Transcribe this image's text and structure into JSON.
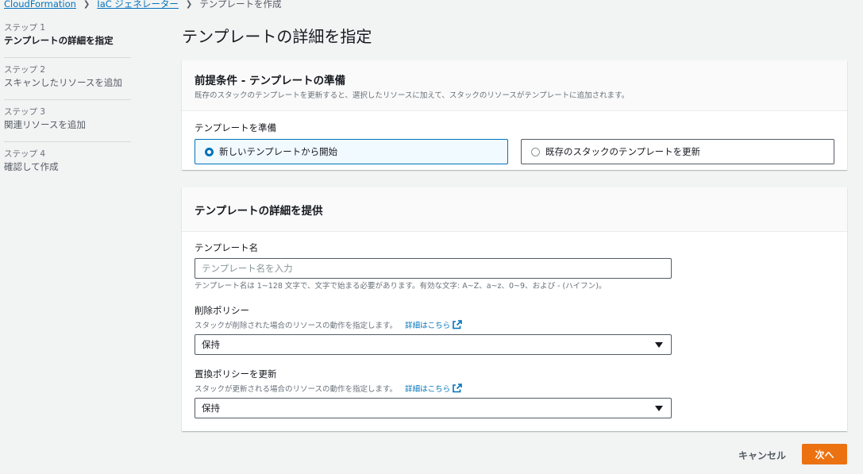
{
  "breadcrumb": {
    "items": [
      "CloudFormation",
      "IaC ジェネレーター"
    ],
    "current": "テンプレートを作成"
  },
  "steps": [
    {
      "num": "ステップ 1",
      "title": "テンプレートの詳細を指定",
      "active": true
    },
    {
      "num": "ステップ 2",
      "title": "スキャンしたリソースを追加",
      "active": false
    },
    {
      "num": "ステップ 3",
      "title": "関連リソースを追加",
      "active": false
    },
    {
      "num": "ステップ 4",
      "title": "確認して作成",
      "active": false
    }
  ],
  "page_title": "テンプレートの詳細を指定",
  "prereq": {
    "title": "前提条件 - テンプレートの準備",
    "description": "既存のスタックのテンプレートを更新すると、選択したリソースに加えて、スタックのリソースがテンプレートに追加されます。",
    "field_label": "テンプレートを準備",
    "options": [
      {
        "label": "新しいテンプレートから開始",
        "selected": true
      },
      {
        "label": "既存のスタックのテンプレートを更新",
        "selected": false
      }
    ]
  },
  "details": {
    "title": "テンプレートの詳細を提供",
    "name_label": "テンプレート名",
    "name_placeholder": "テンプレート名を入力",
    "name_value": "",
    "name_hint": "テンプレート名は 1~128 文字で、文字で始まる必要があります。有効な文字: A~Z、a~z、0~9、および - (ハイフン)。",
    "deletion_label": "削除ポリシー",
    "deletion_desc": "スタックが削除された場合のリソースの動作を指定します。",
    "deletion_link": "詳細はこちら",
    "deletion_value": "保持",
    "replace_label": "置換ポリシーを更新",
    "replace_desc": "スタックが更新される場合のリソースの動作を指定します。",
    "replace_link": "詳細はこちら",
    "replace_value": "保持"
  },
  "footer": {
    "cancel": "キャンセル",
    "next": "次へ"
  },
  "colors": {
    "primary": "#ec7211",
    "link": "#0073bb",
    "background": "#f2f3f3"
  }
}
